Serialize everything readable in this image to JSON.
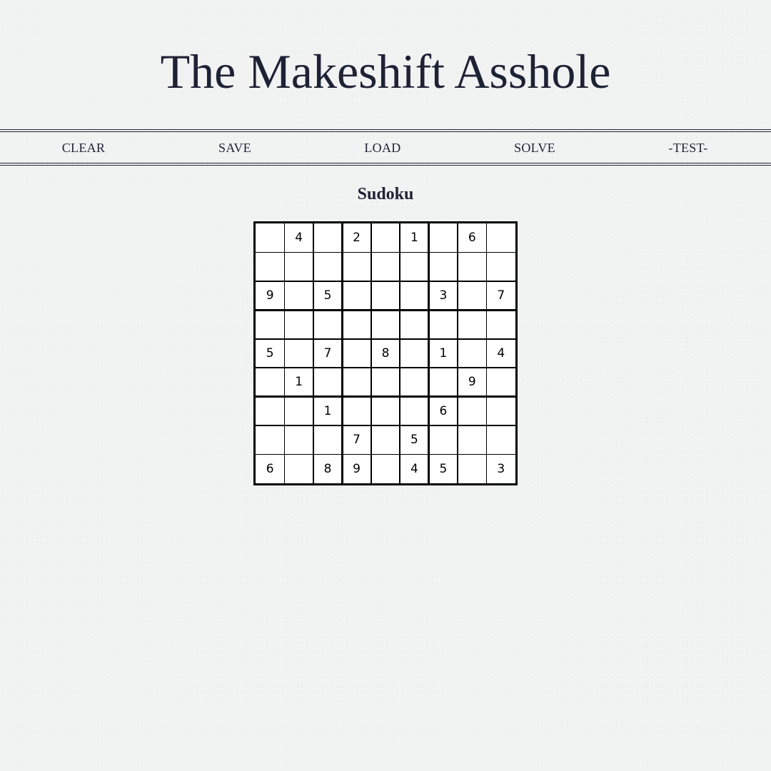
{
  "header": {
    "title": "The Makeshift Asshole"
  },
  "nav": {
    "clear": "CLEAR",
    "save": "SAVE",
    "load": "LOAD",
    "solve": "SOLVE",
    "test": "-TEST-"
  },
  "game": {
    "title": "Sudoku",
    "grid": [
      [
        "",
        "4",
        "",
        "2",
        "",
        "1",
        "",
        "6",
        ""
      ],
      [
        "",
        "",
        "",
        "",
        "",
        "",
        "",
        "",
        ""
      ],
      [
        "9",
        "",
        "5",
        "",
        "",
        "",
        "3",
        "",
        "7"
      ],
      [
        "",
        "",
        "",
        "",
        "",
        "",
        "",
        "",
        ""
      ],
      [
        "5",
        "",
        "7",
        "",
        "8",
        "",
        "1",
        "",
        "4"
      ],
      [
        "",
        "1",
        "",
        "",
        "",
        "",
        "",
        "9",
        ""
      ],
      [
        "",
        "",
        "1",
        "",
        "",
        "",
        "6",
        "",
        ""
      ],
      [
        "",
        "",
        "",
        "7",
        "",
        "5",
        "",
        "",
        ""
      ],
      [
        "6",
        "",
        "8",
        "9",
        "",
        "4",
        "5",
        "",
        "3"
      ]
    ]
  },
  "colors": {
    "background": "#f1f2f2",
    "text": "#1e2235",
    "grid_line": "#000000",
    "cell_background": "#ffffff"
  }
}
